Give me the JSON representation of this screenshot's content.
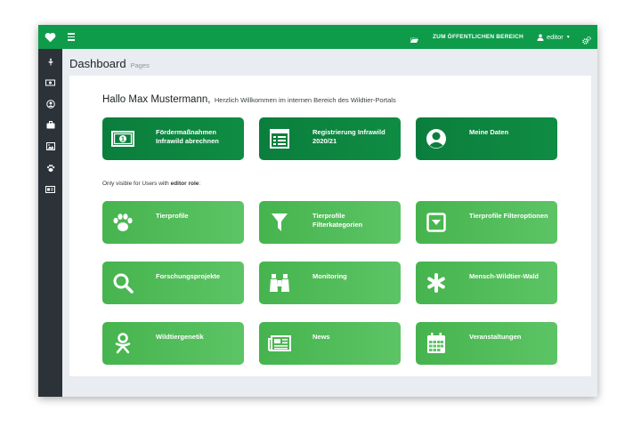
{
  "topbar": {
    "public_link": "ZUM ÖFFENTLICHEN BEREICH",
    "user": "editor"
  },
  "sidebar": {
    "items": [
      "leaf-icon",
      "money-icon",
      "user-circle-icon",
      "briefcase-icon",
      "image-icon",
      "paw-icon",
      "id-card-icon"
    ]
  },
  "page": {
    "title": "Dashboard",
    "subtitle": "Pages"
  },
  "greeting": {
    "name": "Hallo Max Mustermann,",
    "text": "Herzlich Willkommen im internen Bereich des Wildtier-Portals"
  },
  "note": {
    "prefix": "Only visible for Users with",
    "role": "editor role",
    "suffix": ":"
  },
  "main_tiles": [
    {
      "line1": "Fördermaßnahmen",
      "line2": "Infrawild abrechnen",
      "icon": "banknote-icon"
    },
    {
      "line1": "Registrierung Infrawild",
      "line2": "2020/21",
      "icon": "form-icon"
    },
    {
      "line1": "Meine Daten",
      "line2": "",
      "icon": "user-icon"
    }
  ],
  "editor_tiles": [
    {
      "line1": "Tierprofile",
      "line2": "",
      "icon": "paw-icon"
    },
    {
      "line1": "Tierprofile",
      "line2": "Filterkategorien",
      "icon": "filter-icon"
    },
    {
      "line1": "Tierprofile Filteroptionen",
      "line2": "",
      "icon": "caret-square-icon"
    },
    {
      "line1": "Forschungsprojekte",
      "line2": "",
      "icon": "search-icon"
    },
    {
      "line1": "Monitoring",
      "line2": "",
      "icon": "binoculars-icon"
    },
    {
      "line1": "Mensch-Wildtier-Wald",
      "line2": "",
      "icon": "asterisk-icon"
    },
    {
      "line1": "Wildtiergenetik",
      "line2": "",
      "icon": "dna-person-icon"
    },
    {
      "line1": "News",
      "line2": "",
      "icon": "newspaper-icon"
    },
    {
      "line1": "Veranstaltungen",
      "line2": "",
      "icon": "calendar-icon"
    }
  ],
  "colors": {
    "topbar": "#0e9c4b",
    "sidebar": "#2b3338",
    "tile_dark": "#0b7e3d",
    "tile_light": "#5cc465"
  }
}
